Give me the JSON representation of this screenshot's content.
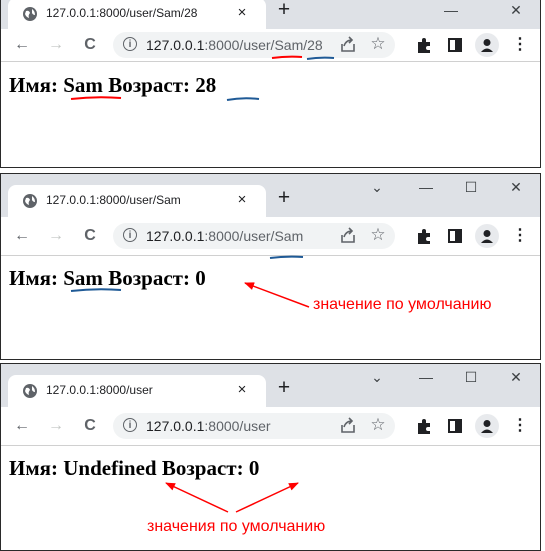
{
  "windows": [
    {
      "tab_title": "127.0.0.1:8000/user/Sam/28",
      "url_host": "127.0.0.1",
      "url_path": ":8000/user/Sam/28",
      "heading_label_name": "Имя:",
      "heading_value_name": "Sam",
      "heading_label_age": "Возраст:",
      "heading_value_age": "28"
    },
    {
      "tab_title": "127.0.0.1:8000/user/Sam",
      "url_host": "127.0.0.1",
      "url_path": ":8000/user/Sam",
      "heading_label_name": "Имя:",
      "heading_value_name": "Sam",
      "heading_label_age": "Возраст:",
      "heading_value_age": "0",
      "annotation": "значение по умолчанию"
    },
    {
      "tab_title": "127.0.0.1:8000/user",
      "url_host": "127.0.0.1",
      "url_path": ":8000/user",
      "heading_label_name": "Имя:",
      "heading_value_name": "Undefined",
      "heading_label_age": "Возраст:",
      "heading_value_age": "0",
      "annotation": "значения по умолчанию"
    }
  ],
  "icons": {
    "tab_close": "×",
    "new_tab": "+",
    "back": "←",
    "forward": "→",
    "reload": "C",
    "info": "i",
    "star": "☆",
    "menu": "⋮",
    "minimize": "—",
    "maximize": "☐",
    "close": "✕",
    "dropdown": "⌄"
  },
  "colors": {
    "annotation_red": "#ff0000",
    "annotation_blue": "#1f5a96",
    "tabstrip": "#dee1e6"
  }
}
